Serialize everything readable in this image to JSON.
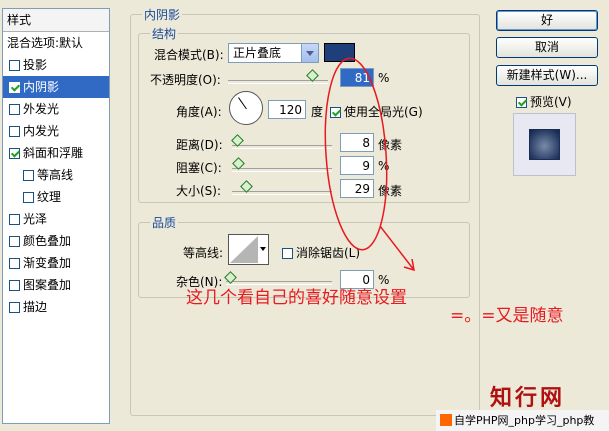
{
  "sidebar": {
    "header": "样式",
    "items": [
      {
        "label": "混合选项:默认",
        "checkbox": false
      },
      {
        "label": "投影",
        "checkbox": true,
        "checked": false
      },
      {
        "label": "内阴影",
        "checkbox": true,
        "checked": true,
        "selected": true
      },
      {
        "label": "外发光",
        "checkbox": true,
        "checked": false
      },
      {
        "label": "内发光",
        "checkbox": true,
        "checked": false
      },
      {
        "label": "斜面和浮雕",
        "checkbox": true,
        "checked": true
      },
      {
        "label": "等高线",
        "checkbox": true,
        "checked": false,
        "indent": true
      },
      {
        "label": "纹理",
        "checkbox": true,
        "checked": false,
        "indent": true
      },
      {
        "label": "光泽",
        "checkbox": true,
        "checked": false
      },
      {
        "label": "颜色叠加",
        "checkbox": true,
        "checked": false
      },
      {
        "label": "渐变叠加",
        "checkbox": true,
        "checked": false
      },
      {
        "label": "图案叠加",
        "checkbox": true,
        "checked": false
      },
      {
        "label": "描边",
        "checkbox": true,
        "checked": false
      }
    ]
  },
  "inner_shadow": {
    "title": "内阴影",
    "structure": {
      "title": "结构",
      "blend_mode_label": "混合模式(B):",
      "blend_mode_value": "正片叠底",
      "swatch_color": "#1f3f7a",
      "opacity_label": "不透明度(O):",
      "opacity_value": "81",
      "opacity_unit": "%",
      "angle_label": "角度(A):",
      "angle_value": "120",
      "angle_unit": "度",
      "global_light_label": "使用全局光(G)",
      "distance_label": "距离(D):",
      "distance_value": "8",
      "distance_unit": "像素",
      "choke_label": "阻塞(C):",
      "choke_value": "9",
      "choke_unit": "%",
      "size_label": "大小(S):",
      "size_value": "29",
      "size_unit": "像素"
    },
    "quality": {
      "title": "品质",
      "contour_label": "等高线:",
      "anti_alias_label": "消除锯齿(L)",
      "noise_label": "杂色(N):",
      "noise_value": "0",
      "noise_unit": "%"
    }
  },
  "buttons": {
    "ok": "好",
    "cancel": "取消",
    "new_style": "新建样式(W)...",
    "preview_label": "预览(V)"
  },
  "annotations": {
    "note1": "这几个看自己的喜好随意设置",
    "note2": "=。=又是随意"
  },
  "watermark": {
    "logo_text": "知行网",
    "footer_text": "自学PHP网_php学习_php教"
  }
}
